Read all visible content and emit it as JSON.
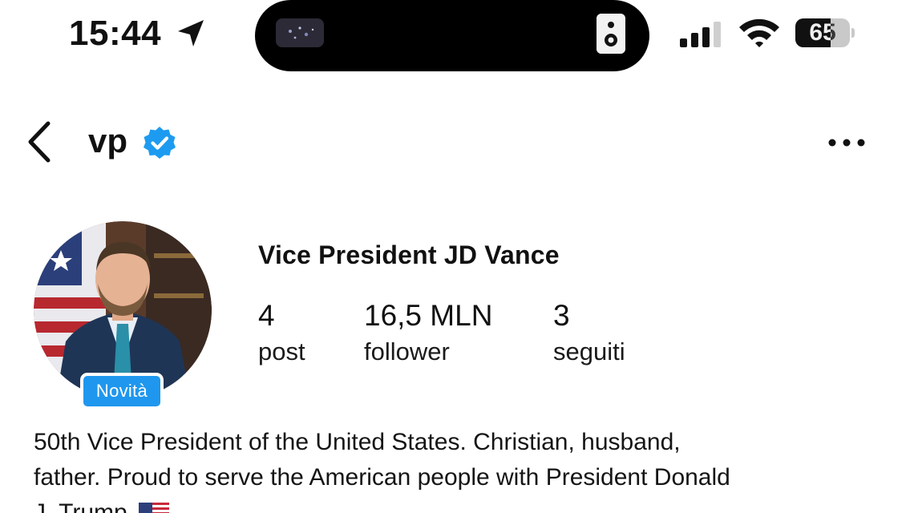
{
  "status_bar": {
    "time": "15:44",
    "location_icon": "location-arrow-icon",
    "signal_icon": "cellular-signal-icon",
    "wifi_icon": "wifi-icon",
    "battery_level": "65",
    "battery_fraction": 0.65
  },
  "header": {
    "back_icon": "chevron-left-icon",
    "username": "vp",
    "verified_icon": "verified-badge-icon",
    "more_icon": "more-horizontal-icon"
  },
  "profile": {
    "badge_label": "Novità",
    "display_name": "Vice President JD Vance",
    "stats": {
      "posts": {
        "value": "4",
        "label": "post"
      },
      "followers": {
        "value": "16,5 MLN",
        "label": "follower"
      },
      "following": {
        "value": "3",
        "label": "seguiti"
      }
    },
    "bio_lines": [
      "50th Vice President of the United States. Christian, husband,",
      "father. Proud to serve the American people with President Donald",
      "J. Trump."
    ],
    "flag_icon": "us-flag-icon"
  },
  "colors": {
    "accent_blue": "#1f97ee",
    "verified_blue": "#1d9bf0",
    "text": "#111111",
    "background": "#ffffff"
  }
}
